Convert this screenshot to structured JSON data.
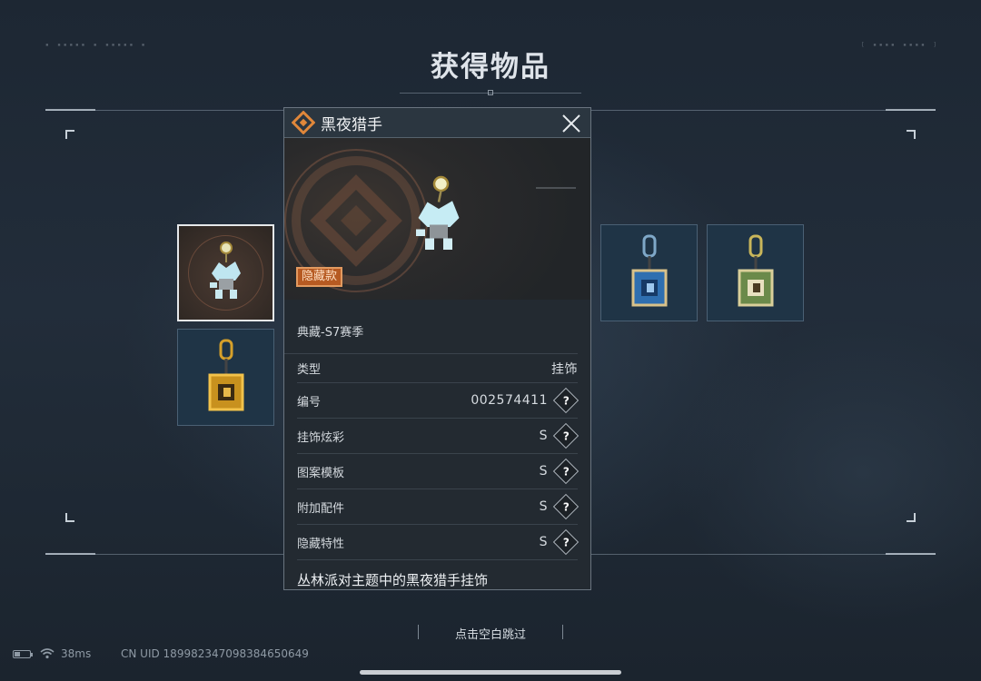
{
  "page": {
    "title": "获得物品"
  },
  "dialog": {
    "title": "黑夜猎手",
    "badge": "隐藏款",
    "season": "典藏-S7赛季",
    "rows": [
      {
        "label": "类型",
        "value": "挂饰",
        "help": false
      },
      {
        "label": "编号",
        "value": "002574411",
        "help": true
      },
      {
        "label": "挂饰炫彩",
        "value": "S",
        "help": true
      },
      {
        "label": "图案模板",
        "value": "S",
        "help": true
      },
      {
        "label": "附加配件",
        "value": "S",
        "help": true
      },
      {
        "label": "隐藏特性",
        "value": "S",
        "help": true
      }
    ],
    "help_symbol": "?",
    "description": "丛林派对主题中的黑夜猎手挂饰"
  },
  "footer": {
    "skip_hint": "点击空白跳过",
    "ping": "38ms",
    "uid": "CN UID 18998234709838465064​9",
    "battery_level": 0.35
  },
  "colors": {
    "badge": "#b65a22",
    "accent_orange": "#e0873a",
    "selected_border": "#e5e8ea"
  },
  "icons": [
    "diamond-logo-icon",
    "close-icon",
    "wifi-icon",
    "battery-icon",
    "help-icon"
  ]
}
